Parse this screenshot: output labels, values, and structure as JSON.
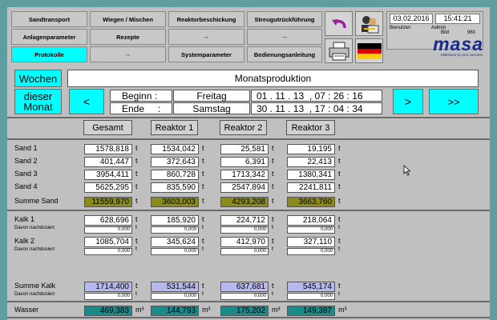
{
  "nav": {
    "row1": [
      "Sandtransport",
      "Wiegen / Mischen",
      "Reaktorbeschickung",
      "Streugutrückführung"
    ],
    "row2": [
      "Anlagenparameter",
      "Rezepte",
      "--",
      "--"
    ],
    "row3": [
      "Protokolle",
      "--",
      "Systemparameter",
      "Bedienungsanleitung"
    ]
  },
  "status": {
    "date": "03.02.2016",
    "time": "15:41:21",
    "user_label": "Benutzer:",
    "user_value": "Admin",
    "bild_label": "Bild",
    "bild_value": "960"
  },
  "logo": {
    "name": "masa",
    "tagline": "Milestone to your success."
  },
  "period": {
    "wochen_label": "Wochen",
    "monat_label": "dieser Monat",
    "title": "Monatsproduktion",
    "prev": "<",
    "next": ">",
    "next_fast": ">>"
  },
  "range": {
    "begin_label": "Beginn :",
    "begin_day": "Freitag",
    "begin_date": "01 . 11 . 13",
    "begin_time": ", 07 : 26 : 16",
    "end_label": "Ende     :",
    "end_day": "Samstag",
    "end_date": "30 . 11 . 13",
    "end_time": ", 17 : 04 : 34"
  },
  "columns": [
    "Gesamt",
    "Reaktor 1",
    "Reaktor 2",
    "Reaktor 3"
  ],
  "units": {
    "mass": "t",
    "volume": "m³"
  },
  "rows": {
    "sand1": {
      "label": "Sand 1",
      "values": [
        "1578,818",
        "1534,042",
        "25,581",
        "19,195"
      ]
    },
    "sand2": {
      "label": "Sand 2",
      "values": [
        "401,447",
        "372,643",
        "6,391",
        "22,413"
      ]
    },
    "sand3": {
      "label": "Sand 3",
      "values": [
        "3954,411",
        "860,728",
        "1713,342",
        "1380,341"
      ]
    },
    "sand4": {
      "label": "Sand 4",
      "values": [
        "5625,295",
        "835,590",
        "2547,894",
        "2241,811"
      ]
    },
    "summe_sand": {
      "label": "Summe Sand",
      "values": [
        "11559,970",
        "3603,003",
        "4293,208",
        "3663,760"
      ]
    },
    "kalk1": {
      "label": "Kalk 1",
      "values": [
        "628,696",
        "185,920",
        "224,712",
        "218,064"
      ],
      "sub_label": "Davon nachdosiert",
      "sub_values": [
        "0,000",
        "0,000",
        "0,000",
        "0,000"
      ]
    },
    "kalk2": {
      "label": "Kalk 2",
      "values": [
        "1085,704",
        "345,624",
        "412,970",
        "327,110"
      ],
      "sub_label": "Davon nachdosiert",
      "sub_values": [
        "0,000",
        "0,000",
        "0,000",
        "0,000"
      ]
    },
    "summe_kalk": {
      "label": "Summe Kalk",
      "values": [
        "1714,400",
        "531,544",
        "637,681",
        "545,174"
      ],
      "sub_label": "Davon nachdosiert",
      "sub_values": [
        "0,000",
        "0,000",
        "0,000",
        "0,000"
      ]
    },
    "wasser": {
      "label": "Wasser",
      "values": [
        "469,383",
        "144,793",
        "175,202",
        "149,387"
      ]
    }
  }
}
